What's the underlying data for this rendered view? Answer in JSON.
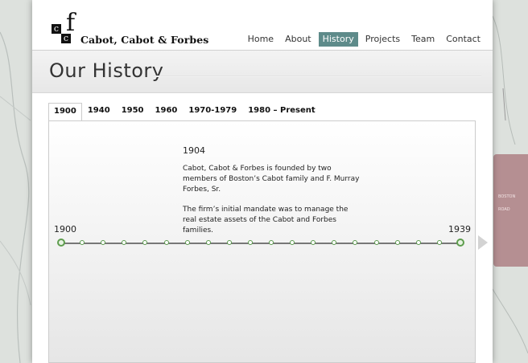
{
  "header": {
    "logo_letters": [
      "c",
      "f",
      "c"
    ],
    "brand_name": "Cabot, Cabot & Forbes",
    "nav": [
      {
        "label": "Home",
        "active": false
      },
      {
        "label": "About",
        "active": false
      },
      {
        "label": "History",
        "active": true
      },
      {
        "label": "Projects",
        "active": false
      },
      {
        "label": "Team",
        "active": false
      },
      {
        "label": "Contact",
        "active": false
      }
    ]
  },
  "page_title": "Our History",
  "tabs": [
    {
      "label": "1900",
      "active": true
    },
    {
      "label": "1940",
      "active": false
    },
    {
      "label": "1950",
      "active": false
    },
    {
      "label": "1960",
      "active": false
    },
    {
      "label": "1970-1979",
      "active": false
    },
    {
      "label": "1980 – Present",
      "active": false
    }
  ],
  "event": {
    "year": "1904",
    "paragraphs": [
      "Cabot, Cabot & Forbes is founded by two members of Boston’s Cabot family and F. Murray Forbes, Sr.",
      "The firm’s initial mandate was to manage the real estate assets of the Cabot and Forbes families."
    ]
  },
  "timeline": {
    "start_label": "1900",
    "end_label": "1939",
    "marker_count": 20
  },
  "background_sign_text": [
    "BOSTON",
    "ROAD"
  ],
  "colors": {
    "nav_active": "#5e8b8a",
    "timeline_dot": "#5c9a4e"
  }
}
